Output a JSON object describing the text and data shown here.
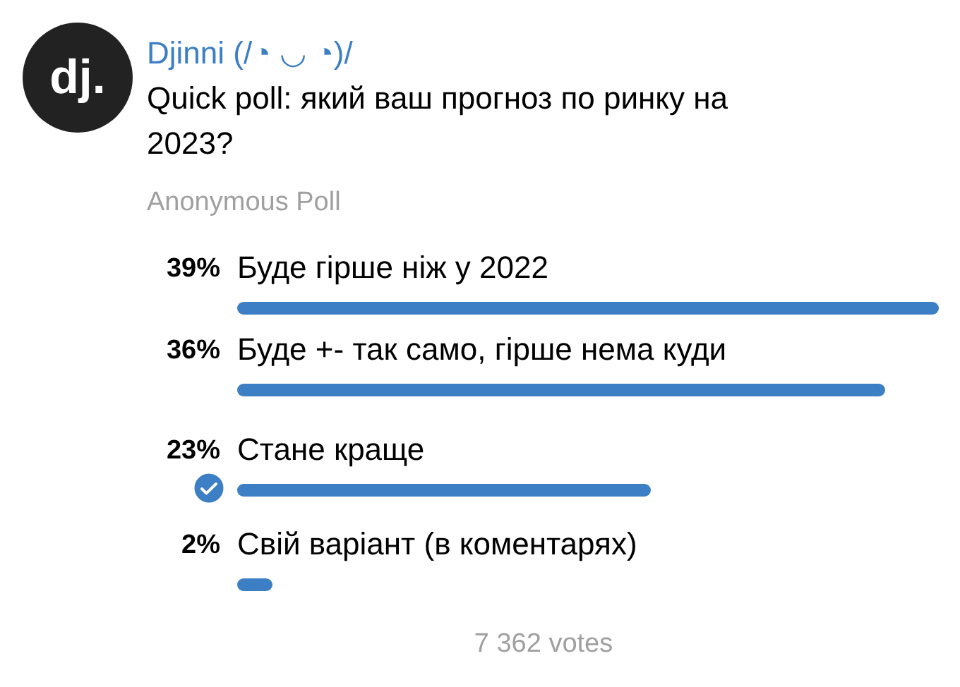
{
  "channel": {
    "name": "Djinni (/◔ ◡ ◔)/",
    "avatar_text": "dj."
  },
  "poll": {
    "question": "Quick poll: який ваш прогноз по ринку на 2023?",
    "type_label": "Anonymous Poll",
    "options": [
      {
        "percent": "39%",
        "text": "Буде гірше ніж у 2022",
        "selected": false
      },
      {
        "percent": "36%",
        "text": "Буде +- так само, гірше нема куди",
        "selected": false
      },
      {
        "percent": "23%",
        "text": "Стане краще",
        "selected": true
      },
      {
        "percent": "2%",
        "text": "Свій варіант (в коментарях)",
        "selected": false
      }
    ],
    "votes": "7 362 votes"
  }
}
